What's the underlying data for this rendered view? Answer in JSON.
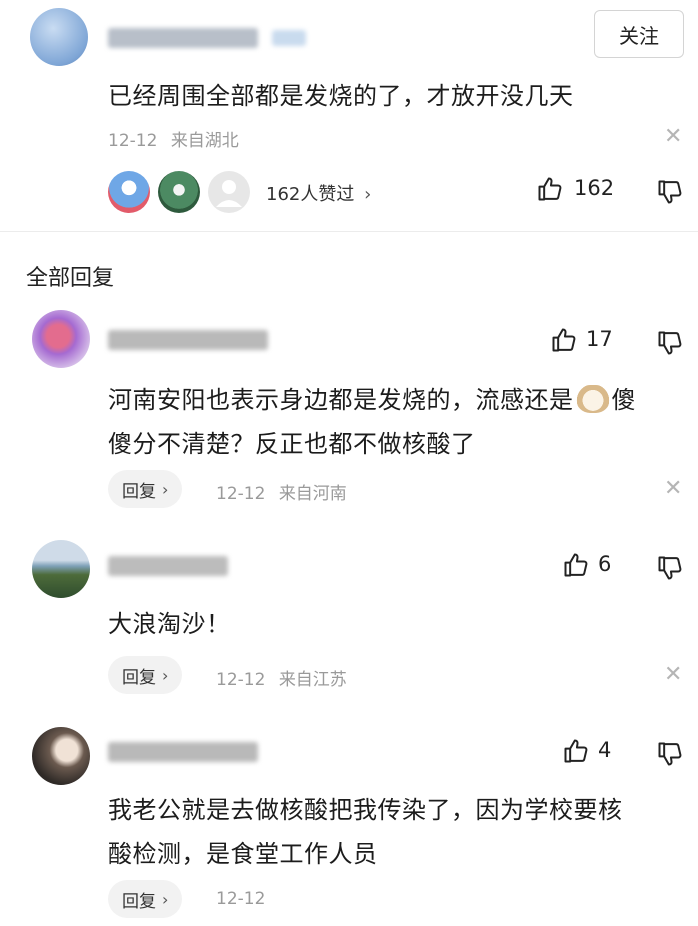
{
  "top_comment": {
    "follow_label": "关注",
    "text": "已经周围全部都是发烧的了，才放开没几天",
    "date": "12-12",
    "location": "来自湖北",
    "likers_text": "162人赞过",
    "like_count": "162"
  },
  "section_title": "全部回复",
  "replies": [
    {
      "like_count": "17",
      "text_line1": "河南安阳也表示身边都是发烧的，流感还是",
      "text_line1_end": "傻",
      "text_line2": "傻分不清楚？反正也都不做核酸了",
      "reply_label": "回复",
      "date": "12-12",
      "location": "来自河南"
    },
    {
      "like_count": "6",
      "text_line1": "大浪淘沙！",
      "reply_label": "回复",
      "date": "12-12",
      "location": "来自江苏"
    },
    {
      "like_count": "4",
      "text_line1": "我老公就是去做核酸把我传染了，因为学校要核",
      "text_line2": "酸检测，是食堂工作人员",
      "reply_label": "回复",
      "date": "12-12"
    }
  ],
  "colors": {
    "text": "#1c1c1c",
    "meta": "#9a9a9a",
    "reply_bg": "#f2f2f2",
    "divider": "#ececec"
  }
}
